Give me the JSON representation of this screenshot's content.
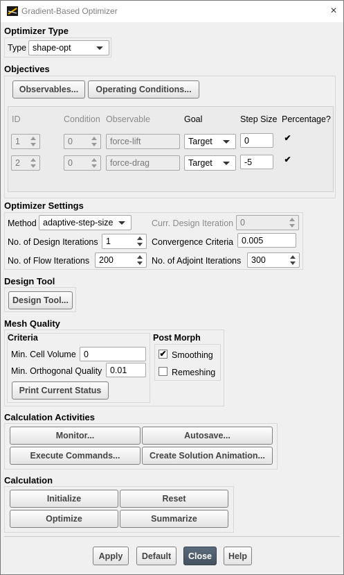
{
  "window": {
    "title": "Gradient-Based Optimizer",
    "close": "×"
  },
  "optimizer_type": {
    "heading": "Optimizer Type",
    "type_label": "Type",
    "type_value": "shape-opt"
  },
  "objectives": {
    "heading": "Objectives",
    "observables_button": "Observables...",
    "operating_conditions_button": "Operating Conditions...",
    "columns": {
      "id": "ID",
      "condition": "Condition",
      "observable": "Observable",
      "goal": "Goal",
      "step_size": "Step Size",
      "percentage": "Percentage?"
    },
    "rows": [
      {
        "id": "1",
        "condition": "0",
        "observable": "force-lift",
        "goal": "Target",
        "step_size": "0",
        "percentage": "✔"
      },
      {
        "id": "2",
        "condition": "0",
        "observable": "force-drag",
        "goal": "Target",
        "step_size": "-5",
        "percentage": "✔"
      }
    ]
  },
  "optimizer_settings": {
    "heading": "Optimizer Settings",
    "method_label": "Method",
    "method_value": "adaptive-step-size",
    "curr_iter_label": "Curr. Design Iteration",
    "curr_iter_value": "0",
    "design_iter_label": "No. of Design Iterations",
    "design_iter_value": "1",
    "convergence_label": "Convergence Criteria",
    "convergence_value": "0.005",
    "flow_iter_label": "No. of Flow Iterations",
    "flow_iter_value": "200",
    "adjoint_iter_label": "No. of Adjoint Iterations",
    "adjoint_iter_value": "300"
  },
  "design_tool": {
    "heading": "Design Tool",
    "button": "Design Tool..."
  },
  "mesh_quality": {
    "heading": "Mesh Quality",
    "criteria_heading": "Criteria",
    "min_cell_volume_label": "Min. Cell Volume",
    "min_cell_volume_value": "0",
    "min_orth_label": "Min. Orthogonal Quality",
    "min_orth_value": "0.01",
    "print_status_button": "Print Current Status",
    "post_morph_heading": "Post Morph",
    "smoothing_label": "Smoothing",
    "smoothing_checked": "✔",
    "remeshing_label": "Remeshing"
  },
  "calculation_activities": {
    "heading": "Calculation Activities",
    "monitor": "Monitor...",
    "autosave": "Autosave...",
    "execute": "Execute Commands...",
    "animation": "Create Solution Animation..."
  },
  "calculation": {
    "heading": "Calculation",
    "initialize": "Initialize",
    "reset": "Reset",
    "optimize": "Optimize",
    "summarize": "Summarize"
  },
  "footer": {
    "apply": "Apply",
    "default": "Default",
    "close": "Close",
    "help": "Help"
  }
}
